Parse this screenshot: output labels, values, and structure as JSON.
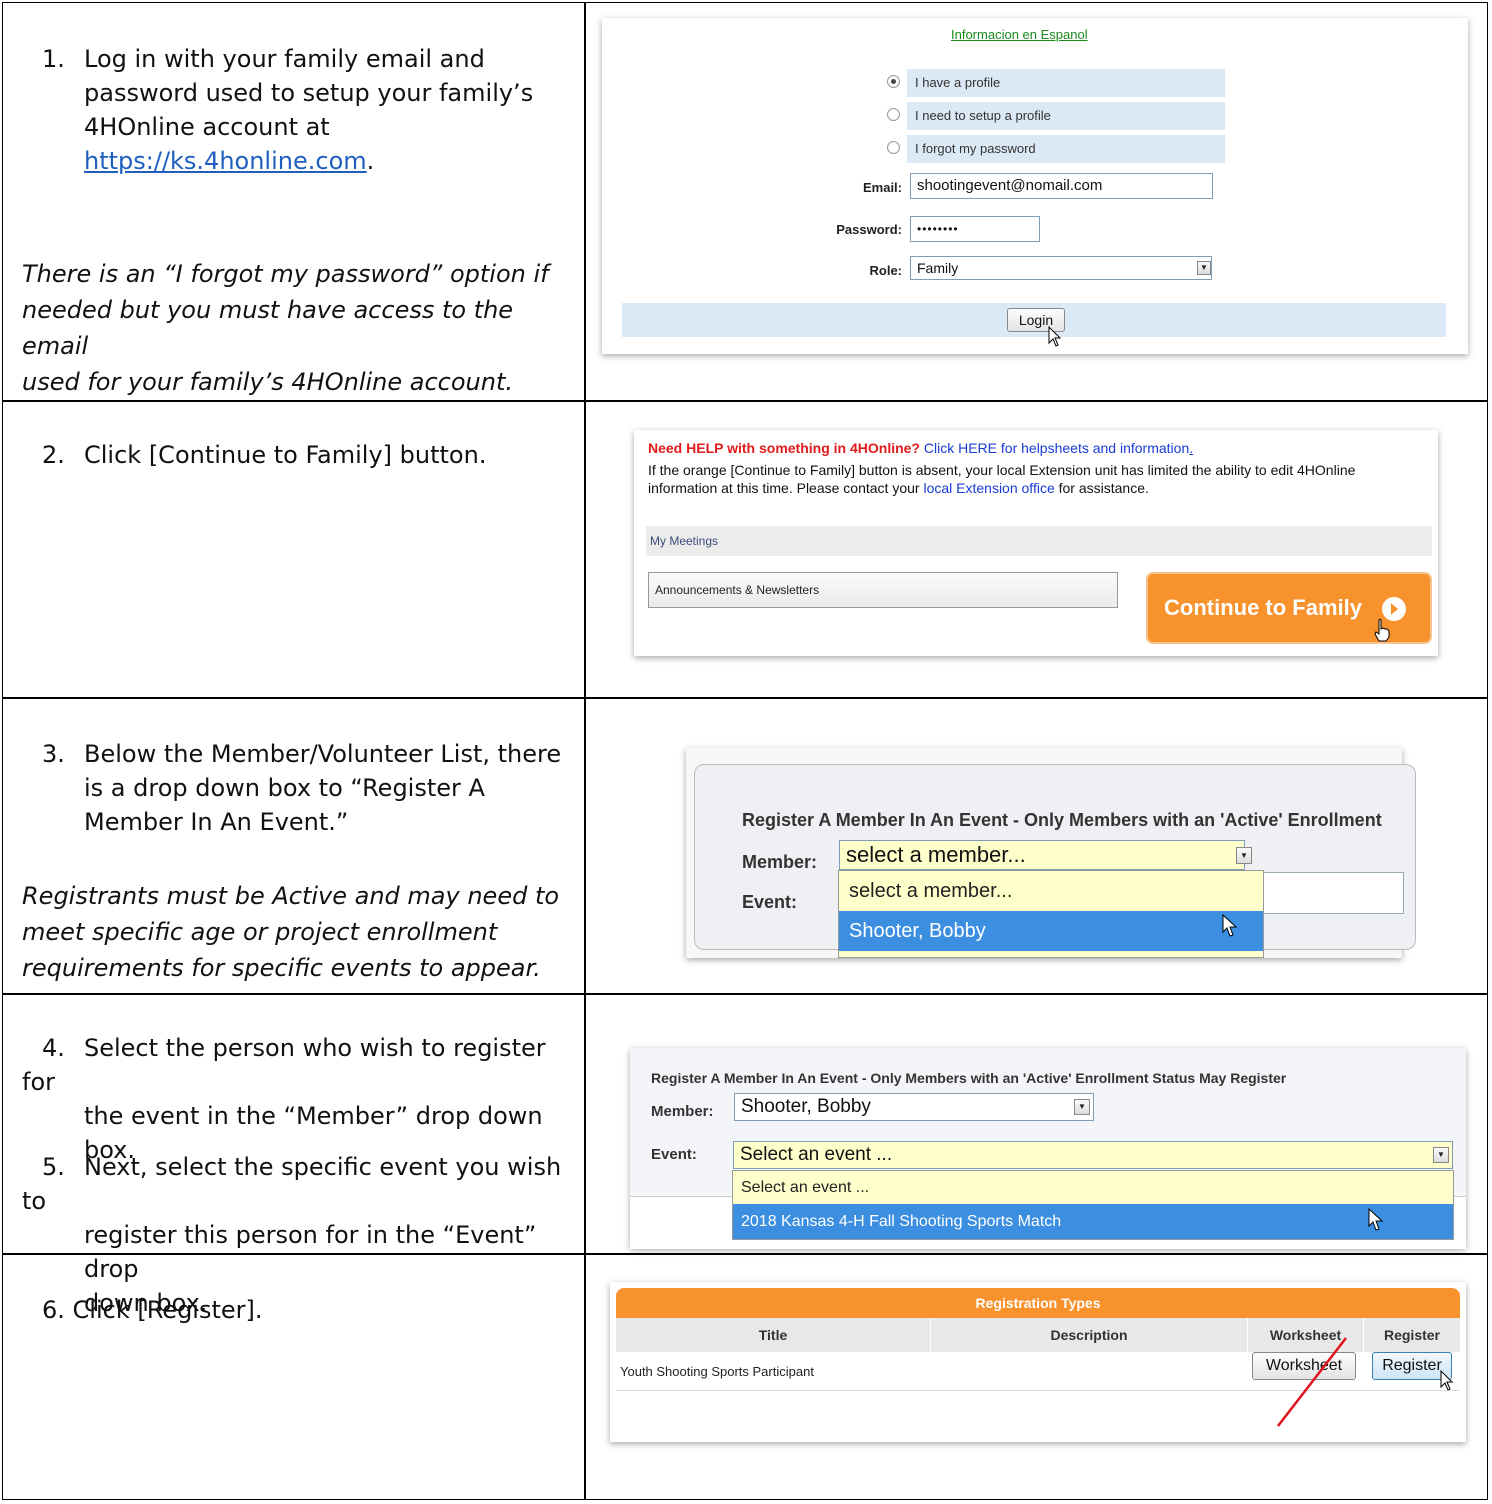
{
  "steps": {
    "s1": {
      "num": "1.",
      "line1": "Log in with your family email and",
      "line2": "password used to setup your family’s",
      "line3": "4HOnline account at",
      "link": "https://ks.4honline.com",
      "after_link": "."
    },
    "s1_note": {
      "l1": "There is an “I forgot my password” option if",
      "l2": "needed but you must have access to the email",
      "l3": "used for your family’s 4HOnline account."
    },
    "s2": {
      "num": "2.",
      "line1": "Click [Continue to Family] button."
    },
    "s3": {
      "num": "3.",
      "line1": "Below the Member/Volunteer List, there",
      "line2": "is a drop down box to “Register A",
      "line3": "Member In An Event.”"
    },
    "s3_note": {
      "l1": "Registrants must be Active and may need to",
      "l2": "meet specific age or project enrollment",
      "l3": "requirements for specific events to appear."
    },
    "s4": {
      "num": "4.",
      "line1": "Select the person who wish to register for",
      "line2": "the event in the “Member” drop down",
      "line3": "box."
    },
    "s5": {
      "num": "5.",
      "line1": "Next, select the specific event you wish to",
      "line2": "register this person for in the “Event” drop",
      "line3": "down box."
    },
    "s6": {
      "text": "6. Click [Register]."
    }
  },
  "login": {
    "spanish_link": "Informacion en Espanol",
    "options": [
      "I have a profile",
      "I need to setup a profile",
      "I forgot my password"
    ],
    "selected_option": 0,
    "email_label": "Email:",
    "email_value": "shootingevent@nomail.com",
    "password_label": "Password:",
    "password_value": "••••••••",
    "role_label": "Role:",
    "role_value": "Family",
    "login_button": "Login"
  },
  "home": {
    "help_bold": "Need HELP with something in 4HOnline?",
    "help_link": "Click HERE for helpsheets and information",
    "help_dot": ".",
    "notice_1": "If the orange [Continue to Family] button is absent, your local Extension unit has limited the ability to edit 4HOnline",
    "notice_2a": "information at this time.  Please contact your",
    "notice_link": "local Extension office",
    "notice_2b": "for assistance.",
    "meetings": "My Meetings",
    "announcements": "Announcements & Newsletters",
    "continue_button": "Continue to Family"
  },
  "register1": {
    "heading": "Register A Member In An Event - Only Members with an 'Active' Enrollment",
    "member_label": "Member:",
    "member_value": "select a member...",
    "event_label": "Event:",
    "options": [
      "select a member...",
      "Shooter, Bobby"
    ]
  },
  "register2": {
    "heading": "Register A Member In An Event - Only Members with an 'Active' Enrollment Status May Register",
    "member_label": "Member:",
    "member_value": "Shooter, Bobby",
    "event_label": "Event:",
    "event_value": "Select an event ...",
    "options": [
      "Select an event ...",
      "2018 Kansas 4-H Fall Shooting Sports Match"
    ]
  },
  "regtypes": {
    "title": "Registration Types",
    "columns": [
      "Title",
      "Description",
      "Worksheet",
      "Register"
    ],
    "row_title": "Youth Shooting Sports Participant",
    "worksheet_button": "Worksheet",
    "register_button": "Register"
  },
  "colors": {
    "orange": "#f7922c",
    "light_blue": "#dbe8f5",
    "select_blue": "#3b8ee0",
    "pale_yellow": "#ffffcc"
  }
}
